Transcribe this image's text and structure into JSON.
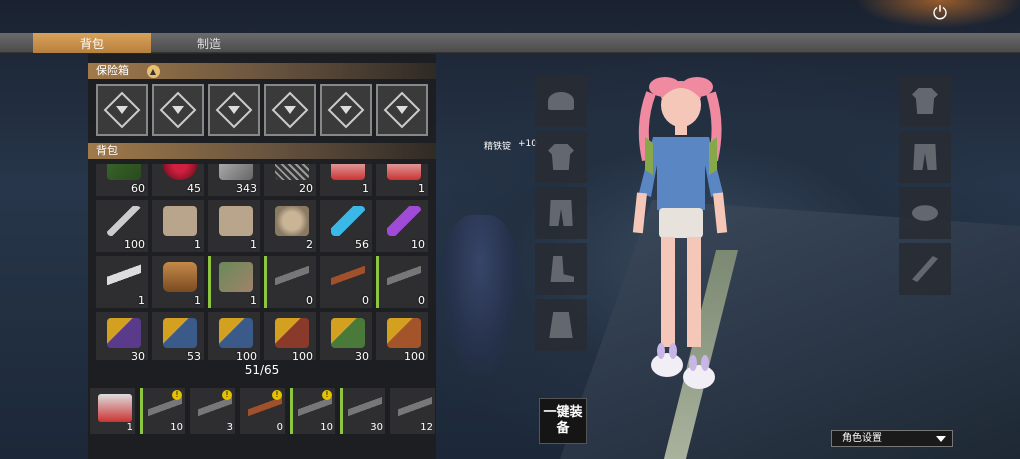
{
  "tabs": [
    {
      "label": "背包",
      "active": true
    },
    {
      "label": "制造",
      "active": false
    }
  ],
  "safe_box": {
    "title": "保险箱",
    "slot_count": 6
  },
  "backpack": {
    "title": "背包",
    "capacity": "51/65",
    "items": [
      {
        "icon": "crate",
        "count": "60",
        "bar": false
      },
      {
        "icon": "berry",
        "count": "45",
        "bar": false
      },
      {
        "icon": "metal",
        "count": "343",
        "bar": false
      },
      {
        "icon": "nails",
        "count": "20",
        "bar": false
      },
      {
        "icon": "can",
        "count": "1",
        "bar": false
      },
      {
        "icon": "can",
        "count": "1",
        "bar": false
      },
      {
        "icon": "syringe",
        "count": "100",
        "bar": false
      },
      {
        "icon": "paper",
        "count": "1",
        "bar": false
      },
      {
        "icon": "paper",
        "count": "1",
        "bar": false
      },
      {
        "icon": "gear",
        "count": "2",
        "bar": false
      },
      {
        "icon": "tube-blue",
        "count": "56",
        "bar": false
      },
      {
        "icon": "tube-purple",
        "count": "10",
        "bar": false
      },
      {
        "icon": "gun",
        "count": "1",
        "bar": false
      },
      {
        "icon": "jar",
        "count": "1",
        "bar": false
      },
      {
        "icon": "cleaver",
        "count": "1",
        "bar": true
      },
      {
        "icon": "rifle",
        "count": "0",
        "bar": true
      },
      {
        "icon": "ak",
        "count": "0",
        "bar": false
      },
      {
        "icon": "rifle",
        "count": "0",
        "bar": true
      },
      {
        "icon": "ammo-y",
        "count": "30",
        "bar": false
      },
      {
        "icon": "ammo-b",
        "count": "53",
        "bar": false
      },
      {
        "icon": "ammo-b",
        "count": "100",
        "bar": false
      },
      {
        "icon": "ammo-r",
        "count": "100",
        "bar": false
      },
      {
        "icon": "ammo-g",
        "count": "30",
        "bar": false
      },
      {
        "icon": "ammo-o",
        "count": "100",
        "bar": false
      }
    ]
  },
  "quick_bar": [
    {
      "icon": "bag",
      "count": "1",
      "bar": false,
      "warn": false
    },
    {
      "icon": "rifle",
      "count": "10",
      "bar": true,
      "warn": true
    },
    {
      "icon": "rifle",
      "count": "3",
      "bar": false,
      "warn": true
    },
    {
      "icon": "ak",
      "count": "0",
      "bar": false,
      "warn": true
    },
    {
      "icon": "rifle",
      "count": "10",
      "bar": true,
      "warn": true
    },
    {
      "icon": "rifle",
      "count": "30",
      "bar": true,
      "warn": false
    },
    {
      "icon": "rifle",
      "count": "12",
      "bar": false,
      "warn": false
    }
  ],
  "equipment": {
    "item_name": "精铁锭",
    "item_bonus": "+10",
    "equip_all_label": "一键装备",
    "character_settings_label": "角色设置"
  },
  "colors": {
    "accent_bar": "#8ec63f",
    "tab_active": "#c8924a"
  }
}
